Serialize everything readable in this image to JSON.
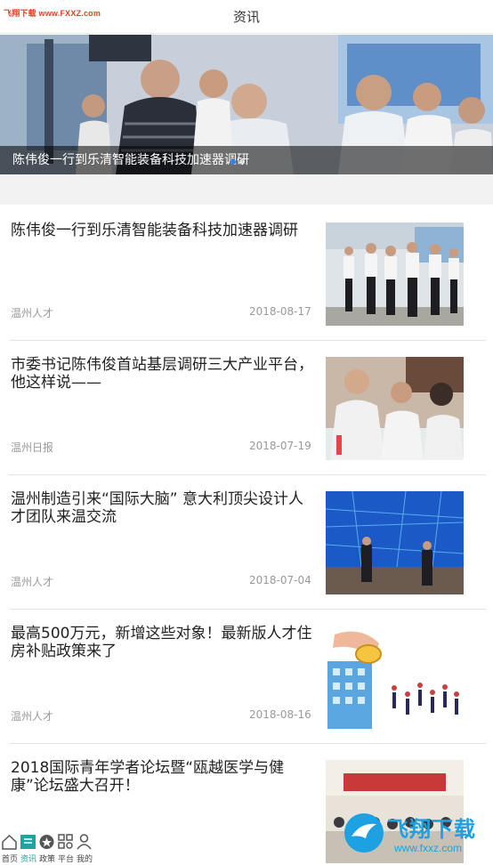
{
  "watermark": "飞翔下载 www.FXXZ.com",
  "header": {
    "title": "资讯"
  },
  "banner": {
    "caption": "陈伟俊一行到乐清智能装备科技加速器调研",
    "dots": 2,
    "active_dot": 0
  },
  "news": [
    {
      "title": "陈伟俊一行到乐清智能装备科技加速器调研",
      "source": "温州人才",
      "date": "2018-08-17",
      "thumb": "officials-walking-photo"
    },
    {
      "title": "市委书记陈伟俊首站基层调研三大产业平台，他这样说——",
      "source": "温州日报",
      "date": "2018-07-19",
      "thumb": "meeting-table-photo"
    },
    {
      "title": "温州制造引来“国际大脑” 意大利顶尖设计人才团队来温交流",
      "source": "温州人才",
      "date": "2018-07-04",
      "thumb": "stage-screen-photo"
    },
    {
      "title": "最高500万元，新增这些对象！最新版人才住房补贴政策来了",
      "source": "温州人才",
      "date": "2018-08-16",
      "thumb": "coin-illustration"
    },
    {
      "title": "2018国际青年学者论坛暨“瓯越医学与健康”论坛盛大召开！",
      "source": "",
      "date": "",
      "thumb": "forum-audience-photo"
    }
  ],
  "tabbar": [
    {
      "label": "首页",
      "icon": "home-icon",
      "active": false
    },
    {
      "label": "资讯",
      "icon": "news-icon",
      "active": true
    },
    {
      "label": "政策",
      "icon": "policy-icon",
      "active": false
    },
    {
      "label": "平台",
      "icon": "platform-icon",
      "active": false
    },
    {
      "label": "我的",
      "icon": "user-icon",
      "active": false
    }
  ],
  "brand": {
    "name": "飞翔下载",
    "url": "www.fxxz.com",
    "icon": "bird-logo-icon"
  },
  "colors": {
    "accent": "#1aa5a0",
    "brand": "#1da1e2",
    "dot_active": "#2f80ed"
  }
}
